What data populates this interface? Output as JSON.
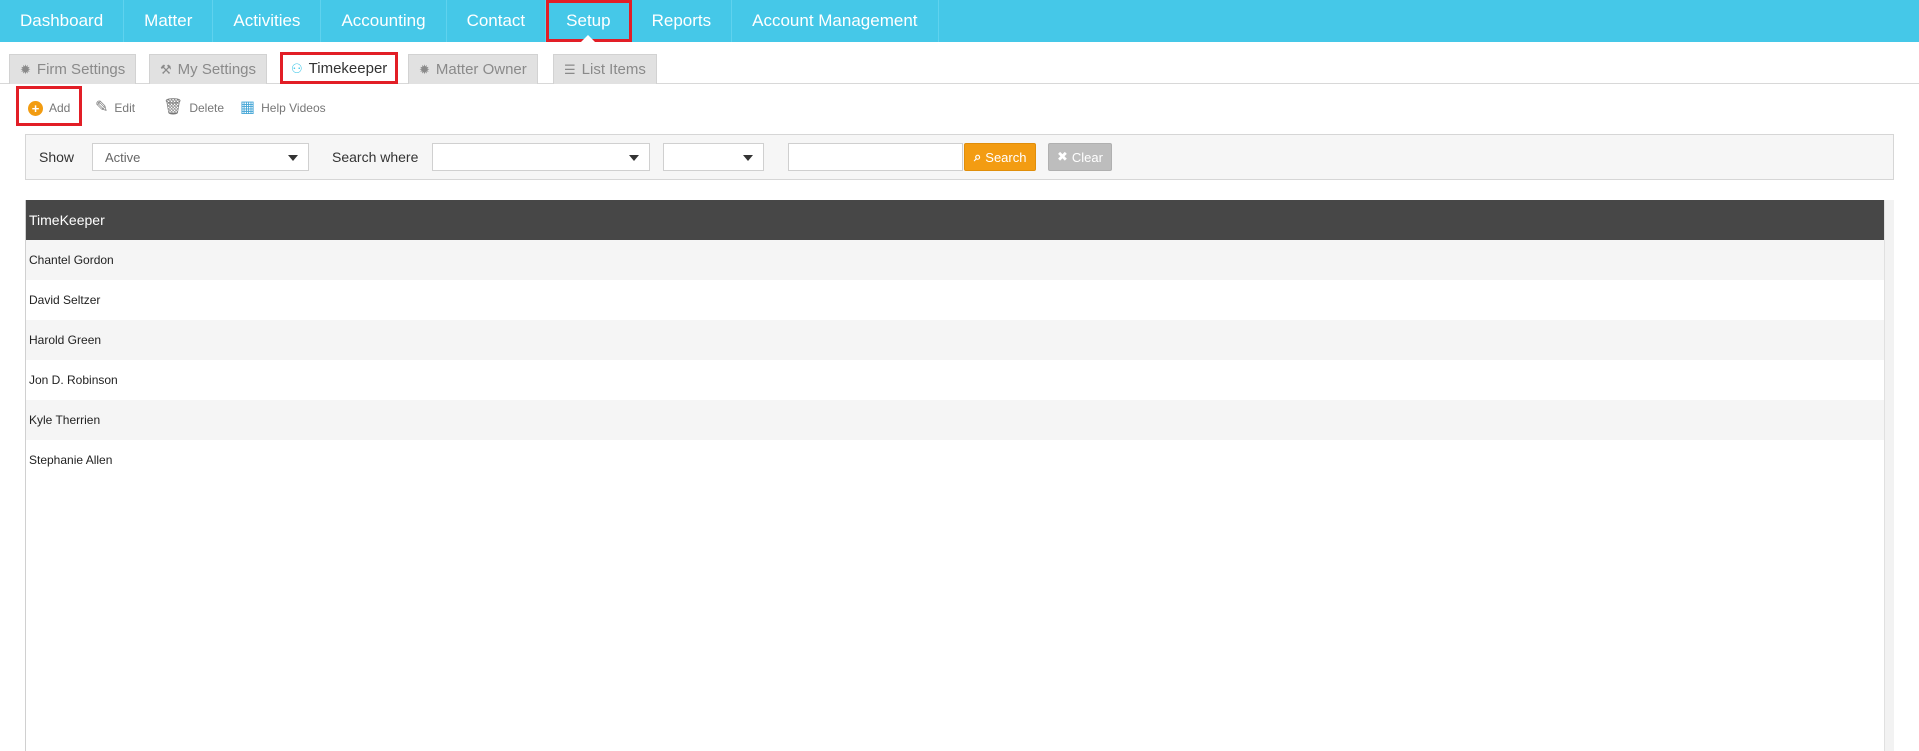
{
  "topnav": {
    "items": [
      {
        "label": "Dashboard"
      },
      {
        "label": "Matter"
      },
      {
        "label": "Activities"
      },
      {
        "label": "Accounting"
      },
      {
        "label": "Contact"
      },
      {
        "label": "Setup",
        "active": true
      },
      {
        "label": "Reports"
      },
      {
        "label": "Account Management"
      }
    ]
  },
  "subtabs": {
    "items": [
      {
        "label": "Firm Settings",
        "icon": "gear-icon"
      },
      {
        "label": "My Settings",
        "icon": "tools-icon"
      },
      {
        "label": "Timekeeper",
        "icon": "users-icon",
        "active": true
      },
      {
        "label": "Matter Owner",
        "icon": "gear-icon"
      },
      {
        "label": "List Items",
        "icon": "list-icon"
      }
    ]
  },
  "toolbar": {
    "add_label": "Add",
    "edit_label": "Edit",
    "delete_label": "Delete",
    "help_label": "Help Videos"
  },
  "filter": {
    "show_label": "Show",
    "show_value": "Active",
    "search_where_label": "Search where",
    "search_where_value": "",
    "operator_value": "",
    "search_text": "",
    "search_button": "Search",
    "clear_button": "Clear"
  },
  "grid": {
    "header": "TimeKeeper",
    "rows": [
      "Chantel Gordon",
      "David Seltzer",
      "Harold Green",
      "Jon D. Robinson",
      "Kyle Therrien",
      "Stephanie Allen"
    ]
  },
  "colors": {
    "nav_bg": "#45c8e8",
    "highlight": "#e21e26",
    "search_button": "#f39c12",
    "grid_header": "#474747"
  }
}
